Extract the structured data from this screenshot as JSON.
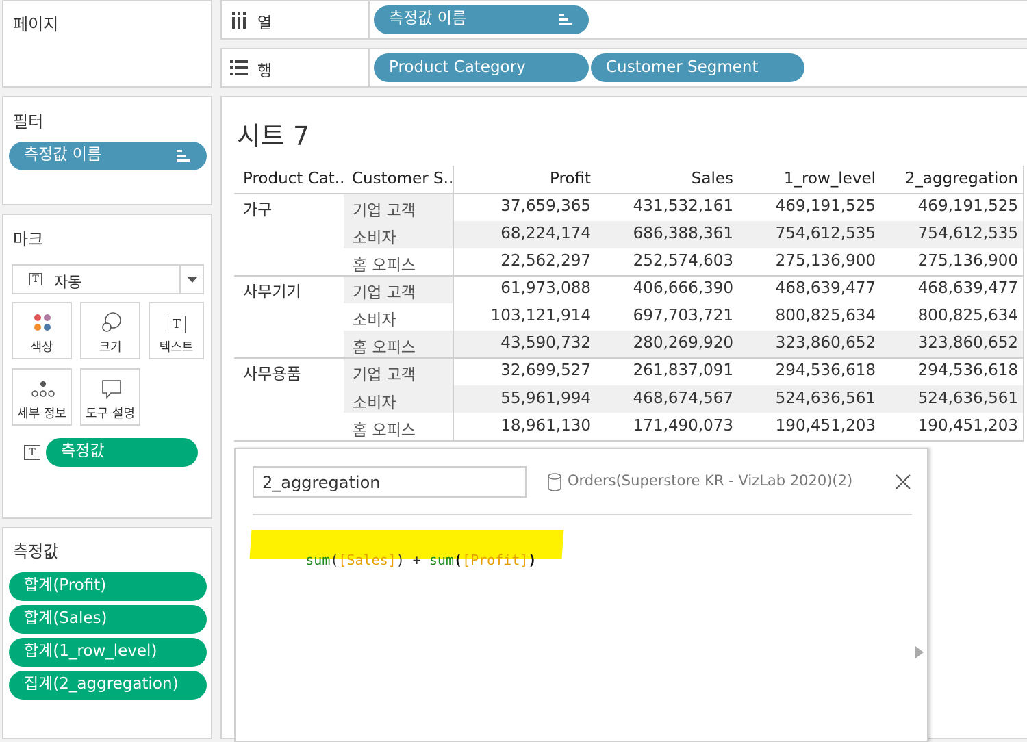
{
  "pages": {
    "title": "페이지"
  },
  "columns_shelf": {
    "label": "열",
    "pills": [
      "측정값 이름"
    ]
  },
  "rows_shelf": {
    "label": "행",
    "pills": [
      "Product Category",
      "Customer Segment"
    ]
  },
  "filters": {
    "title": "필터",
    "pills": [
      "측정값 이름"
    ]
  },
  "marks": {
    "title": "마크",
    "type": "자동",
    "buttons": {
      "color": "색상",
      "size": "크기",
      "text": "텍스트",
      "detail": "세부 정보",
      "tooltip": "도구 설명"
    },
    "text_pill": "측정값"
  },
  "measure_values": {
    "title": "측정값",
    "pills": [
      "합계(Profit)",
      "합계(Sales)",
      "합계(1_row_level)",
      "집계(2_aggregation)"
    ]
  },
  "sheet": {
    "title": "시트 7",
    "headers": [
      "Product Cat..",
      "Customer S..",
      "Profit",
      "Sales",
      "1_row_level",
      "2_aggregation"
    ],
    "groups": [
      {
        "category": "가구",
        "rows": [
          {
            "segment": "기업 고객",
            "values": [
              "37,659,365",
              "431,532,161",
              "469,191,525",
              "469,191,525"
            ]
          },
          {
            "segment": "소비자",
            "values": [
              "68,224,174",
              "686,388,361",
              "754,612,535",
              "754,612,535"
            ]
          },
          {
            "segment": "홈 오피스",
            "values": [
              "22,562,297",
              "252,574,603",
              "275,136,900",
              "275,136,900"
            ]
          }
        ]
      },
      {
        "category": "사무기기",
        "rows": [
          {
            "segment": "기업 고객",
            "values": [
              "61,973,088",
              "406,666,390",
              "468,639,477",
              "468,639,477"
            ]
          },
          {
            "segment": "소비자",
            "values": [
              "103,121,914",
              "697,703,721",
              "800,825,634",
              "800,825,634"
            ]
          },
          {
            "segment": "홈 오피스",
            "values": [
              "43,590,732",
              "280,269,920",
              "323,860,652",
              "323,860,652"
            ]
          }
        ]
      },
      {
        "category": "사무용품",
        "rows": [
          {
            "segment": "기업 고객",
            "values": [
              "32,699,527",
              "261,837,091",
              "294,536,618",
              "294,536,618"
            ]
          },
          {
            "segment": "소비자",
            "values": [
              "55,961,994",
              "468,674,567",
              "524,636,561",
              "524,636,561"
            ]
          },
          {
            "segment": "홈 오피스",
            "values": [
              "18,961,130",
              "171,490,073",
              "190,451,203",
              "190,451,203"
            ]
          }
        ]
      }
    ]
  },
  "calc_editor": {
    "name": "2_aggregation",
    "datasource": "Orders(Superstore KR - VizLab 2020)(2)",
    "formula_tokens": [
      {
        "text": "sum",
        "role": "function"
      },
      {
        "text": "(",
        "role": "paren"
      },
      {
        "text": "[Sales]",
        "role": "field"
      },
      {
        "text": ")",
        "role": "paren"
      },
      {
        "text": " + ",
        "role": "operator"
      },
      {
        "text": "sum",
        "role": "function"
      },
      {
        "text": "(",
        "role": "paren_bold"
      },
      {
        "text": "[Profit]",
        "role": "field"
      },
      {
        "text": ")",
        "role": "paren_bold"
      }
    ]
  },
  "colors": {
    "pill_blue": "#4a96b6",
    "pill_green": "#00ab7a",
    "formula_highlight": "#fff200",
    "formula_function": "#1a8c1a",
    "formula_field": "#e8a000"
  }
}
